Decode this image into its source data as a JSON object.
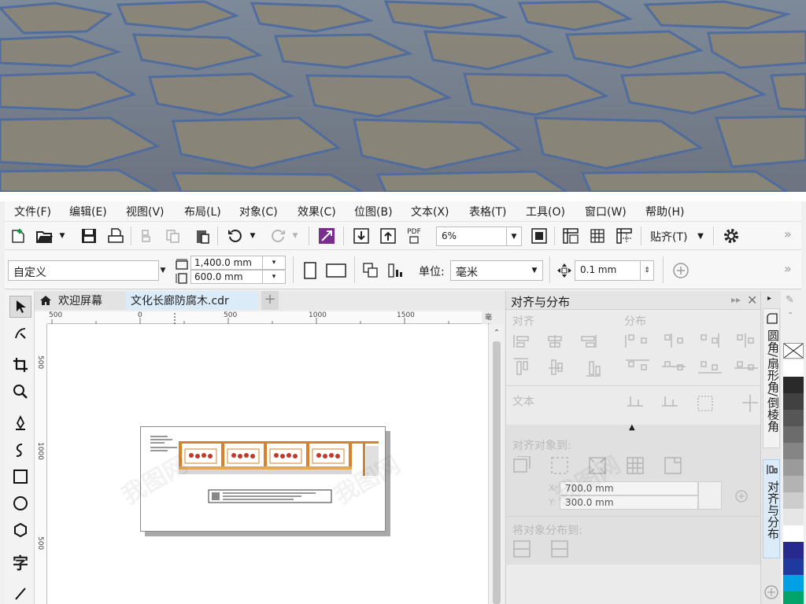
{
  "menubar": {
    "items": [
      "文件(F)",
      "编辑(E)",
      "视图(V)",
      "布局(L)",
      "对象(C)",
      "效果(C)",
      "位图(B)",
      "文本(X)",
      "表格(T)",
      "工具(O)",
      "窗口(W)",
      "帮助(H)"
    ]
  },
  "toolbar": {
    "zoom_value": "6%",
    "snap_label": "贴齐(T)",
    "overflow": "»",
    "pdf_label": "PDF"
  },
  "propbar": {
    "page_preset": "自定义",
    "width_value": "1,400.0 mm",
    "height_value": "600.0 mm",
    "units_label": "单位:",
    "units_value": "毫米",
    "nudge_value": "0.1 mm",
    "overflow": "»"
  },
  "tabs": {
    "welcome": "欢迎屏幕",
    "document": "文化长廊防腐木.cdr",
    "add": "+"
  },
  "ruler": {
    "top_ticks": [
      "500",
      "0",
      "500",
      "1000",
      "1500"
    ],
    "unit": "毫米",
    "left_ticks": [
      "500",
      "1000",
      "500"
    ]
  },
  "docker": {
    "title": "对齐与分布",
    "section_align": "对齐",
    "section_distribute": "分布",
    "section_text": "文本",
    "align_objects_to": "对齐对象到:",
    "x_label": "X:",
    "x_value": "700.0 mm",
    "y_label": "Y:",
    "y_value": "300.0 mm",
    "distribute_to": "将对象分布到:"
  },
  "sidetabs": {
    "fillet": "圆角/扇形角/倒棱角",
    "align": "对齐与分布"
  },
  "palette": {
    "colors": [
      "#ffffff",
      "#2a2a2a",
      "#414141",
      "#565656",
      "#6c6c6c",
      "#858585",
      "#9b9b9b",
      "#b3b3b3",
      "#cccccc",
      "#e6e6e6",
      "#ffffff",
      "#272a8c",
      "#1d3b9f",
      "#00a0e4",
      "#00a36a"
    ]
  },
  "colors": {
    "accent_purple": "#7b2d8e",
    "tab_active": "#dcebf8"
  }
}
